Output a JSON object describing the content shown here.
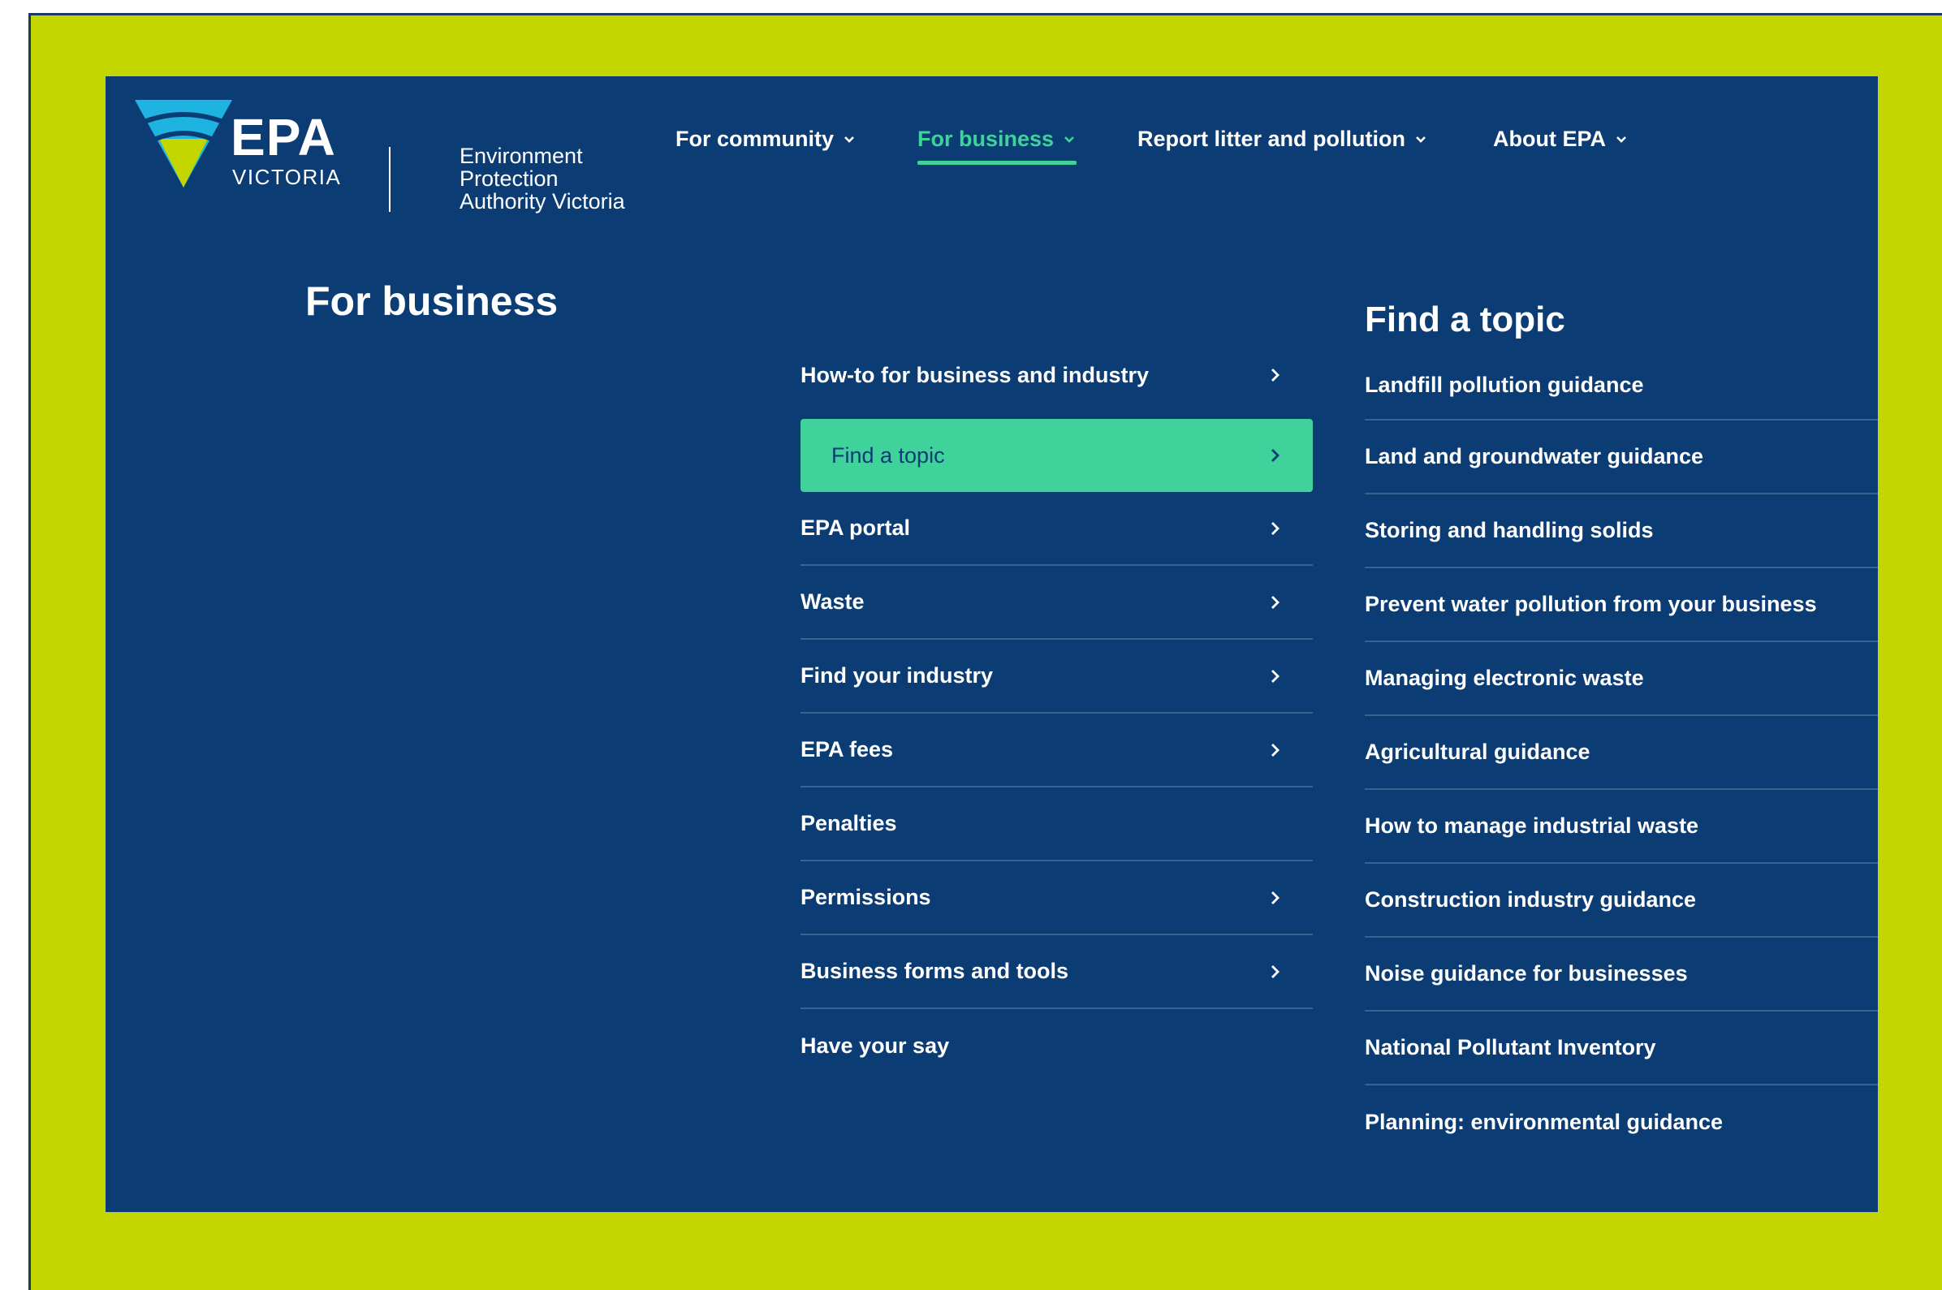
{
  "logo": {
    "wordmark": "EPA",
    "sub": "VICTORIA",
    "org_lines": [
      "Environment",
      "Protection",
      "Authority Victoria"
    ]
  },
  "nav": [
    {
      "label": "For community",
      "active": false
    },
    {
      "label": "For business",
      "active": true
    },
    {
      "label": "Report litter and pollution",
      "active": false
    },
    {
      "label": "About EPA",
      "active": false
    }
  ],
  "section_title": "For business",
  "menu": [
    {
      "label": "How-to for business and industry",
      "chevron": true
    },
    {
      "label": "Find a topic",
      "chevron": true,
      "highlighted": true
    },
    {
      "label": "EPA portal",
      "chevron": true
    },
    {
      "label": "Waste",
      "chevron": true
    },
    {
      "label": "Find your industry",
      "chevron": true
    },
    {
      "label": "EPA fees",
      "chevron": true
    },
    {
      "label": "Penalties",
      "chevron": false
    },
    {
      "label": "Permissions",
      "chevron": true
    },
    {
      "label": "Business forms and tools",
      "chevron": true
    },
    {
      "label": "Have your say",
      "chevron": false
    }
  ],
  "topic_title": "Find a topic",
  "topics": [
    "Landfill pollution guidance",
    "Land and groundwater guidance",
    "Storing and handling solids",
    "Prevent water pollution from your business",
    "Managing electronic waste",
    "Agricultural guidance",
    "How to manage industrial waste",
    "Construction industry guidance",
    "Noise guidance for businesses",
    "National Pollutant Inventory",
    "Planning: environmental guidance"
  ],
  "colors": {
    "frame": "#c4d600",
    "panel": "#0c3c74",
    "accent": "#3fd39b",
    "logo_cyan": "#1fb3e2",
    "logo_lime": "#c4d600"
  }
}
